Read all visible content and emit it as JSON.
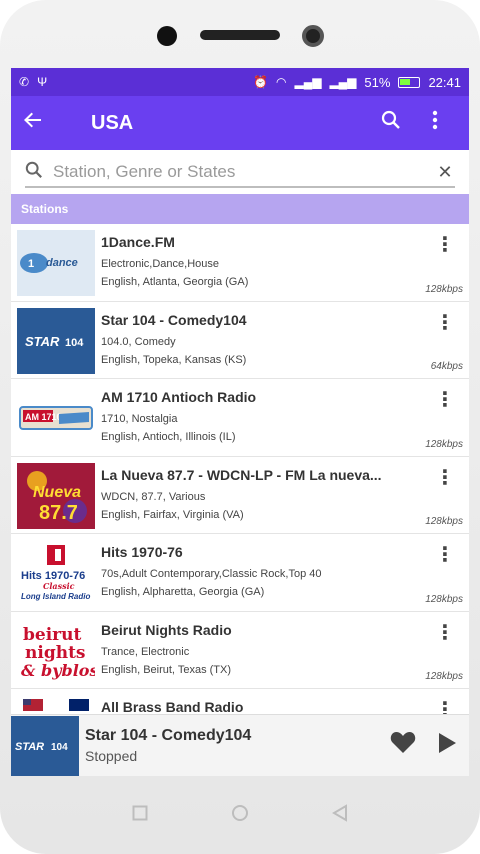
{
  "status_bar": {
    "left_icons": [
      "whatsapp-icon",
      "usb-icon"
    ],
    "battery": "51%",
    "time": "22:41"
  },
  "app_bar": {
    "back_icon": "back-arrow-icon",
    "title": "USA",
    "search_icon": "search-icon",
    "menu_icon": "more-vert-icon"
  },
  "search": {
    "placeholder": "Station, Genre or States",
    "value": ""
  },
  "section": {
    "label": "Stations"
  },
  "stations": [
    {
      "name": "1Dance.FM",
      "genre": "Electronic,Dance,House",
      "location": "English, Atlanta, Georgia (GA)",
      "bitrate": "128kbps",
      "logo_color": "#dfe9f3"
    },
    {
      "name": "Star 104 - Comedy104",
      "genre": "104.0, Comedy",
      "location": "English, Topeka, Kansas (KS)",
      "bitrate": "64kbps",
      "logo_color": "#2a5a96"
    },
    {
      "name": "AM 1710 Antioch Radio",
      "genre": "1710, Nostalgia",
      "location": "English, Antioch, Illinois (IL)",
      "bitrate": "128kbps",
      "logo_color": "#e8e0d0"
    },
    {
      "name": "La Nueva 87.7 - WDCN-LP - FM La nueva...",
      "genre": "WDCN, 87.7, Various",
      "location": "English, Fairfax, Virginia (VA)",
      "bitrate": "128kbps",
      "logo_color": "#a11a3a"
    },
    {
      "name": "Hits 1970-76",
      "genre": "70s,Adult Contemporary,Classic Rock,Top 40",
      "location": "English, Alpharetta, Georgia (GA)",
      "bitrate": "128kbps",
      "logo_color": "#ffffff"
    },
    {
      "name": "Beirut Nights Radio",
      "genre": "Trance, Electronic",
      "location": "English, Beirut, Texas (TX)",
      "bitrate": "128kbps",
      "logo_color": "#ffffff"
    },
    {
      "name": "All Brass Band Radio",
      "genre": "",
      "location": "",
      "bitrate": "",
      "logo_color": "#ffffff"
    }
  ],
  "player": {
    "title": "Star 104 - Comedy104",
    "status": "Stopped",
    "favorite_icon": "heart-icon",
    "play_icon": "play-icon"
  },
  "colors": {
    "status_bar": "#5b2fd6",
    "app_bar": "#6a3ff0",
    "section_header": "#b6a5f0"
  }
}
